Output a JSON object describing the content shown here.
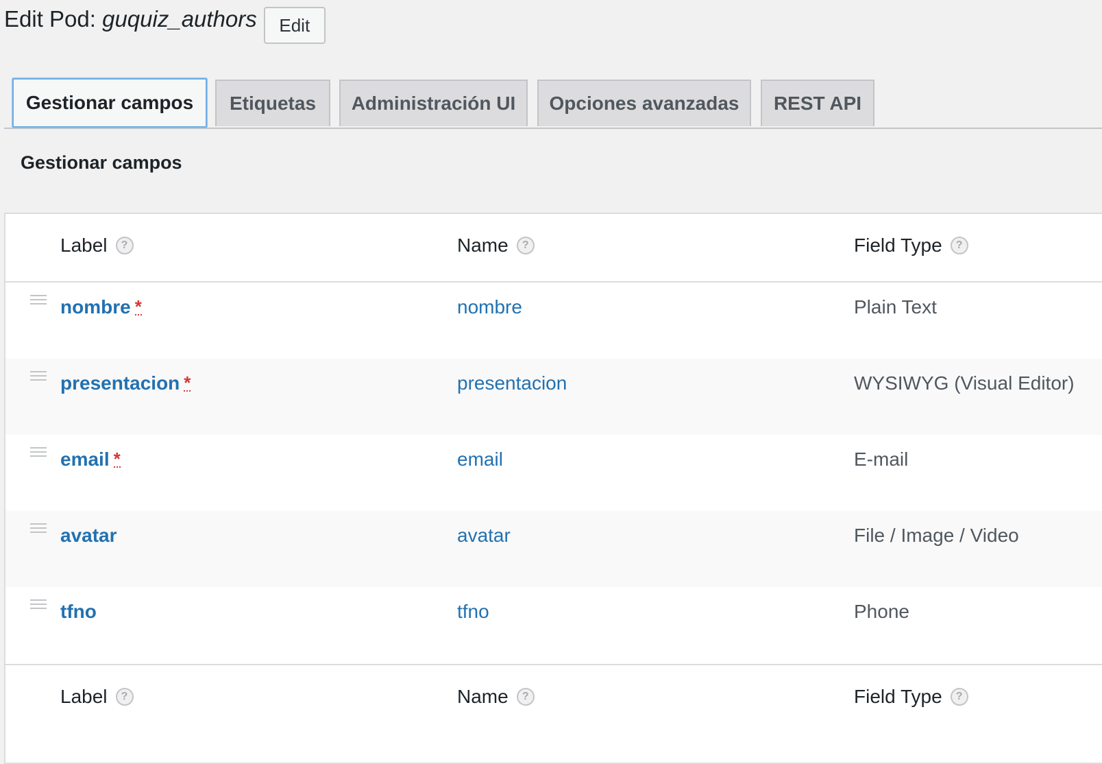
{
  "header": {
    "title_prefix": "Edit Pod:",
    "pod_name": "guquiz_authors",
    "edit_button": "Edit"
  },
  "tabs": [
    {
      "label": "Gestionar campos",
      "active": true
    },
    {
      "label": "Etiquetas",
      "active": false
    },
    {
      "label": "Administración UI",
      "active": false
    },
    {
      "label": "Opciones avanzadas",
      "active": false
    },
    {
      "label": "REST API",
      "active": false
    }
  ],
  "section_title": "Gestionar campos",
  "columns": {
    "label": "Label",
    "name": "Name",
    "field_type": "Field Type",
    "help_glyph": "?"
  },
  "fields": [
    {
      "label": "nombre",
      "required": true,
      "name": "nombre",
      "type": "Plain Text"
    },
    {
      "label": "presentacion",
      "required": true,
      "name": "presentacion",
      "type": "WYSIWYG (Visual Editor)"
    },
    {
      "label": "email",
      "required": true,
      "name": "email",
      "type": "E-mail"
    },
    {
      "label": "avatar",
      "required": false,
      "name": "avatar",
      "type": "File / Image / Video"
    },
    {
      "label": "tfno",
      "required": false,
      "name": "tfno",
      "type": "Phone"
    }
  ],
  "required_marker": "*",
  "icons": {
    "help": "help-icon",
    "drag": "drag-handle-icon"
  },
  "colors": {
    "link": "#2271b1",
    "required": "#d63638",
    "active_tab_border": "#72aee6"
  }
}
